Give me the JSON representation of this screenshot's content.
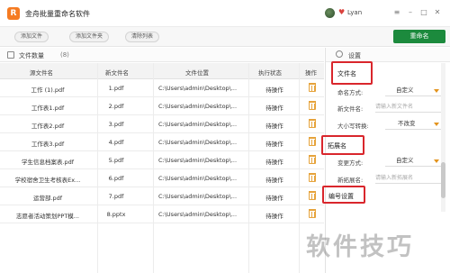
{
  "app": {
    "logo_glyph": "R",
    "title": "金舟批量重命名软件"
  },
  "user": {
    "vip_glyph": "♥",
    "name": "Lyan"
  },
  "window_controls": {
    "menu": "≡",
    "minimize": "–",
    "maximize": "□",
    "close": "✕"
  },
  "toolbar": {
    "add_file": "添加文件",
    "add_folder": "添加文件夹",
    "clear_list": "清除列表",
    "rename": "重命名"
  },
  "file_list": {
    "title": "文件数量",
    "count": "(8)",
    "columns": {
      "original": "源文件名",
      "new": "新文件名",
      "path": "文件位置",
      "status": "执行状态",
      "action": "操作"
    },
    "rows": [
      {
        "original": "工作 (1).pdf",
        "new": "1.pdf",
        "path": "C:\\Users\\admin\\Desktop\\...",
        "status": "待操作"
      },
      {
        "original": "工作表1.pdf",
        "new": "2.pdf",
        "path": "C:\\Users\\admin\\Desktop\\...",
        "status": "待操作"
      },
      {
        "original": "工作表2.pdf",
        "new": "3.pdf",
        "path": "C:\\Users\\admin\\Desktop\\...",
        "status": "待操作"
      },
      {
        "original": "工作表3.pdf",
        "new": "4.pdf",
        "path": "C:\\Users\\admin\\Desktop\\...",
        "status": "待操作"
      },
      {
        "original": "学生信息档案表.pdf",
        "new": "5.pdf",
        "path": "C:\\Users\\admin\\Desktop\\...",
        "status": "待操作"
      },
      {
        "original": "学校宿舍卫生考核表Ex...",
        "new": "6.pdf",
        "path": "C:\\Users\\admin\\Desktop\\...",
        "status": "待操作"
      },
      {
        "original": "运营部.pdf",
        "new": "7.pdf",
        "path": "C:\\Users\\admin\\Desktop\\...",
        "status": "待操作"
      },
      {
        "original": "志愿者活动策划PPT模...",
        "new": "8.pptx",
        "path": "C:\\Users\\admin\\Desktop\\...",
        "status": "待操作"
      }
    ]
  },
  "settings": {
    "title": "设置",
    "filename_section": "文件名",
    "naming_mode_label": "命名方式:",
    "naming_mode_value": "自定义",
    "new_name_label": "新文件名:",
    "new_name_placeholder": "请输入新文件名",
    "case_label": "大小写转换:",
    "case_value": "不改变",
    "ext_section": "拓展名",
    "change_mode_label": "变更方式:",
    "change_mode_value": "自定义",
    "new_ext_label": "新拓展名:",
    "new_ext_placeholder": "请输入新拓展名",
    "numbering_section": "编号设置"
  },
  "watermark": "软件技巧",
  "colors": {
    "accent_green": "#1c8a3d",
    "highlight_red": "#d9262c",
    "caret_orange": "#e3941e",
    "logo_orange": "#f57b22"
  }
}
